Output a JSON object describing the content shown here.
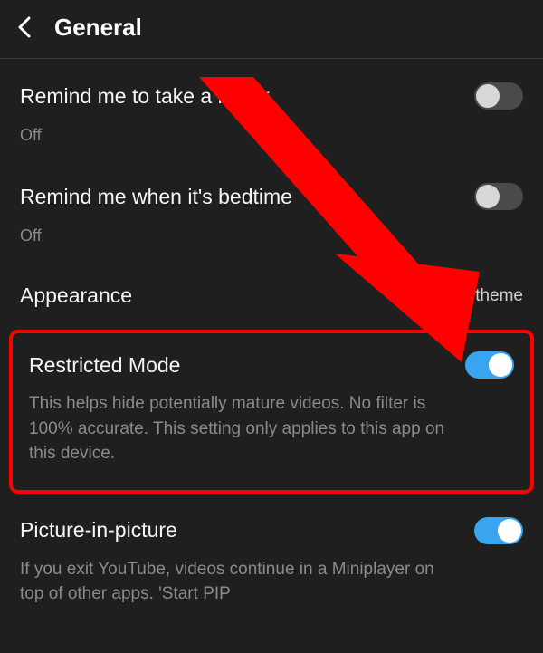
{
  "colors": {
    "background": "#1f1f1f",
    "accent": "#39a5f0",
    "annotation": "#ff0000",
    "text_secondary": "#8a8a8a"
  },
  "header": {
    "title": "General"
  },
  "settings": {
    "remind_break": {
      "title": "Remind me to take a break",
      "status": "Off",
      "enabled": false
    },
    "remind_bedtime": {
      "title": "Remind me when it's bedtime",
      "status": "Off",
      "enabled": false
    },
    "appearance": {
      "title": "Appearance",
      "value": "Dark theme"
    },
    "restricted_mode": {
      "title": "Restricted Mode",
      "description": "This helps hide potentially mature videos. No filter is 100% accurate. This setting only applies to this app on this device.",
      "enabled": true
    },
    "pip": {
      "title": "Picture-in-picture",
      "description": "If you exit YouTube, videos continue in a Miniplayer on top of other apps. 'Start PIP",
      "enabled": true
    }
  },
  "annotation": {
    "type": "arrow_and_box",
    "points_to": "restricted_mode_toggle"
  }
}
